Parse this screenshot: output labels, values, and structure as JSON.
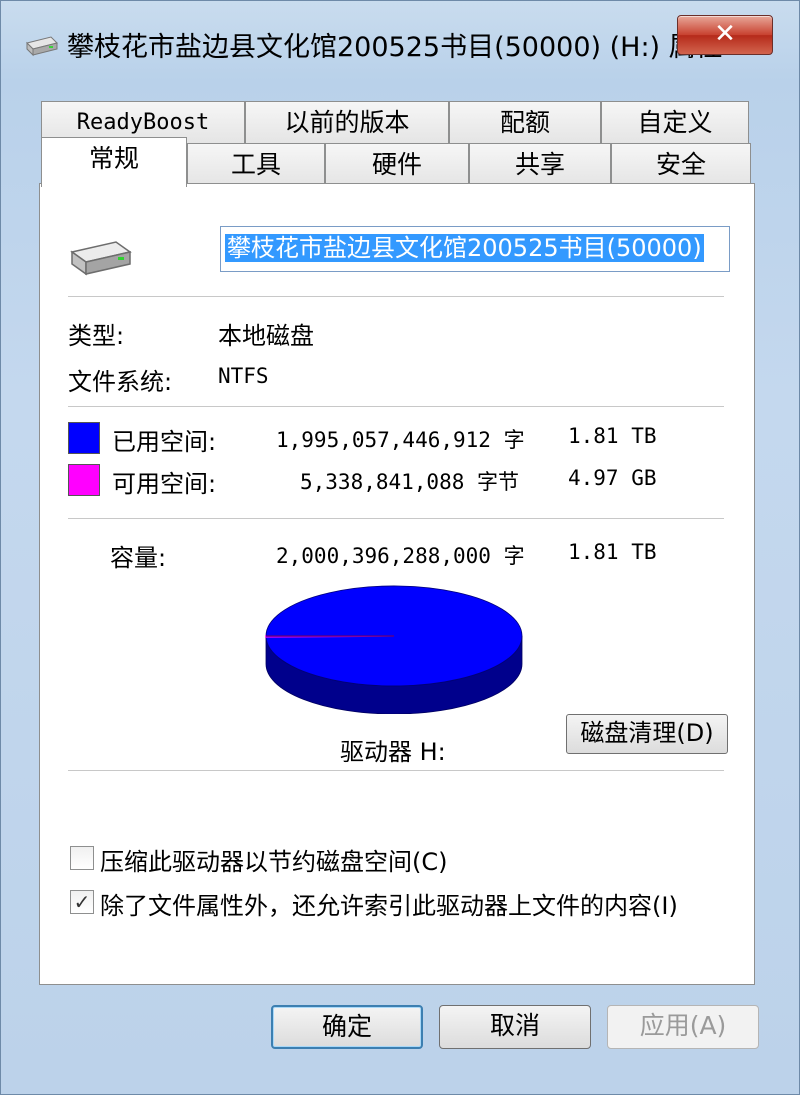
{
  "window": {
    "title": "攀枝花市盐边县文化馆200525书目(50000) (H:) 属性",
    "close_glyph": "✕"
  },
  "tabs": {
    "row_top": [
      "ReadyBoost",
      "以前的版本",
      "配额",
      "自定义"
    ],
    "row_bottom": [
      "常规",
      "工具",
      "硬件",
      "共享",
      "安全"
    ],
    "active": "常规"
  },
  "general": {
    "drive_name": "攀枝花市盐边县文化馆200525书目(50000)",
    "type_label": "类型:",
    "type_value": "本地磁盘",
    "fs_label": "文件系统:",
    "fs_value": "NTFS",
    "used_label": "已用空间:",
    "used_bytes": "1,995,057,446,912 字",
    "used_size": "1.81 TB",
    "free_label": "可用空间:",
    "free_bytes": "5,338,841,088 字节",
    "free_size": "4.97 GB",
    "capacity_label": "容量:",
    "capacity_bytes": "2,000,396,288,000 字",
    "capacity_size": "1.81 TB",
    "drive_label": "驱动器 H:",
    "cleanup_button": "磁盘清理(D)",
    "compress_option": "压缩此驱动器以节约磁盘空间(C)",
    "compress_checked": false,
    "index_option": "除了文件属性外，还允许索引此驱动器上文件的内容(I)",
    "index_checked": true
  },
  "chart_data": {
    "type": "pie",
    "series": [
      {
        "values": [
          1995057446912,
          5338841088
        ]
      }
    ],
    "colors": [
      "#0000ff",
      "#ff00ff"
    ]
  },
  "colors": {
    "used": "#0000ff",
    "free": "#ff00ff",
    "selection": "#3399ff"
  },
  "buttons": {
    "ok": "确定",
    "cancel": "取消",
    "apply": "应用(A)"
  }
}
